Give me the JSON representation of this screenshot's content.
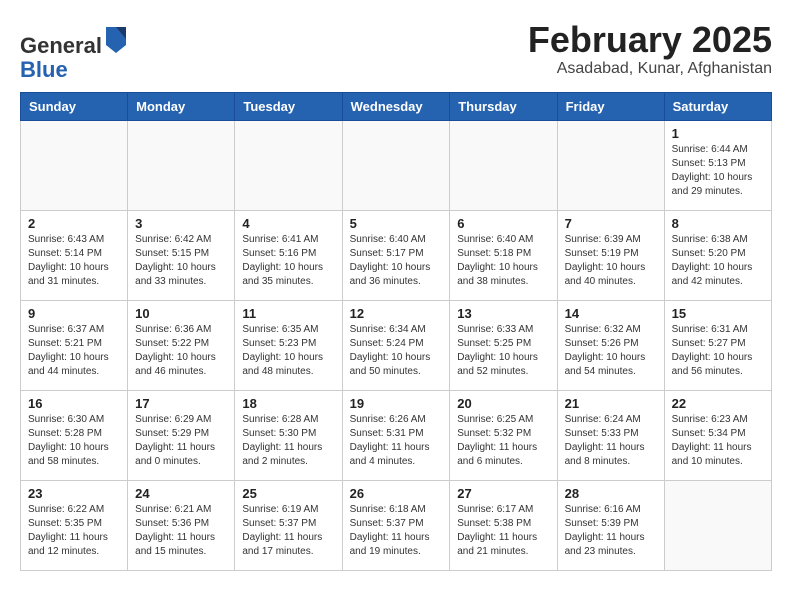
{
  "logo": {
    "general": "General",
    "blue": "Blue"
  },
  "title": "February 2025",
  "location": "Asadabad, Kunar, Afghanistan",
  "weekdays": [
    "Sunday",
    "Monday",
    "Tuesday",
    "Wednesday",
    "Thursday",
    "Friday",
    "Saturday"
  ],
  "weeks": [
    [
      {
        "day": "",
        "info": ""
      },
      {
        "day": "",
        "info": ""
      },
      {
        "day": "",
        "info": ""
      },
      {
        "day": "",
        "info": ""
      },
      {
        "day": "",
        "info": ""
      },
      {
        "day": "",
        "info": ""
      },
      {
        "day": "1",
        "info": "Sunrise: 6:44 AM\nSunset: 5:13 PM\nDaylight: 10 hours and 29 minutes."
      }
    ],
    [
      {
        "day": "2",
        "info": "Sunrise: 6:43 AM\nSunset: 5:14 PM\nDaylight: 10 hours and 31 minutes."
      },
      {
        "day": "3",
        "info": "Sunrise: 6:42 AM\nSunset: 5:15 PM\nDaylight: 10 hours and 33 minutes."
      },
      {
        "day": "4",
        "info": "Sunrise: 6:41 AM\nSunset: 5:16 PM\nDaylight: 10 hours and 35 minutes."
      },
      {
        "day": "5",
        "info": "Sunrise: 6:40 AM\nSunset: 5:17 PM\nDaylight: 10 hours and 36 minutes."
      },
      {
        "day": "6",
        "info": "Sunrise: 6:40 AM\nSunset: 5:18 PM\nDaylight: 10 hours and 38 minutes."
      },
      {
        "day": "7",
        "info": "Sunrise: 6:39 AM\nSunset: 5:19 PM\nDaylight: 10 hours and 40 minutes."
      },
      {
        "day": "8",
        "info": "Sunrise: 6:38 AM\nSunset: 5:20 PM\nDaylight: 10 hours and 42 minutes."
      }
    ],
    [
      {
        "day": "9",
        "info": "Sunrise: 6:37 AM\nSunset: 5:21 PM\nDaylight: 10 hours and 44 minutes."
      },
      {
        "day": "10",
        "info": "Sunrise: 6:36 AM\nSunset: 5:22 PM\nDaylight: 10 hours and 46 minutes."
      },
      {
        "day": "11",
        "info": "Sunrise: 6:35 AM\nSunset: 5:23 PM\nDaylight: 10 hours and 48 minutes."
      },
      {
        "day": "12",
        "info": "Sunrise: 6:34 AM\nSunset: 5:24 PM\nDaylight: 10 hours and 50 minutes."
      },
      {
        "day": "13",
        "info": "Sunrise: 6:33 AM\nSunset: 5:25 PM\nDaylight: 10 hours and 52 minutes."
      },
      {
        "day": "14",
        "info": "Sunrise: 6:32 AM\nSunset: 5:26 PM\nDaylight: 10 hours and 54 minutes."
      },
      {
        "day": "15",
        "info": "Sunrise: 6:31 AM\nSunset: 5:27 PM\nDaylight: 10 hours and 56 minutes."
      }
    ],
    [
      {
        "day": "16",
        "info": "Sunrise: 6:30 AM\nSunset: 5:28 PM\nDaylight: 10 hours and 58 minutes."
      },
      {
        "day": "17",
        "info": "Sunrise: 6:29 AM\nSunset: 5:29 PM\nDaylight: 11 hours and 0 minutes."
      },
      {
        "day": "18",
        "info": "Sunrise: 6:28 AM\nSunset: 5:30 PM\nDaylight: 11 hours and 2 minutes."
      },
      {
        "day": "19",
        "info": "Sunrise: 6:26 AM\nSunset: 5:31 PM\nDaylight: 11 hours and 4 minutes."
      },
      {
        "day": "20",
        "info": "Sunrise: 6:25 AM\nSunset: 5:32 PM\nDaylight: 11 hours and 6 minutes."
      },
      {
        "day": "21",
        "info": "Sunrise: 6:24 AM\nSunset: 5:33 PM\nDaylight: 11 hours and 8 minutes."
      },
      {
        "day": "22",
        "info": "Sunrise: 6:23 AM\nSunset: 5:34 PM\nDaylight: 11 hours and 10 minutes."
      }
    ],
    [
      {
        "day": "23",
        "info": "Sunrise: 6:22 AM\nSunset: 5:35 PM\nDaylight: 11 hours and 12 minutes."
      },
      {
        "day": "24",
        "info": "Sunrise: 6:21 AM\nSunset: 5:36 PM\nDaylight: 11 hours and 15 minutes."
      },
      {
        "day": "25",
        "info": "Sunrise: 6:19 AM\nSunset: 5:37 PM\nDaylight: 11 hours and 17 minutes."
      },
      {
        "day": "26",
        "info": "Sunrise: 6:18 AM\nSunset: 5:37 PM\nDaylight: 11 hours and 19 minutes."
      },
      {
        "day": "27",
        "info": "Sunrise: 6:17 AM\nSunset: 5:38 PM\nDaylight: 11 hours and 21 minutes."
      },
      {
        "day": "28",
        "info": "Sunrise: 6:16 AM\nSunset: 5:39 PM\nDaylight: 11 hours and 23 minutes."
      },
      {
        "day": "",
        "info": ""
      }
    ]
  ]
}
